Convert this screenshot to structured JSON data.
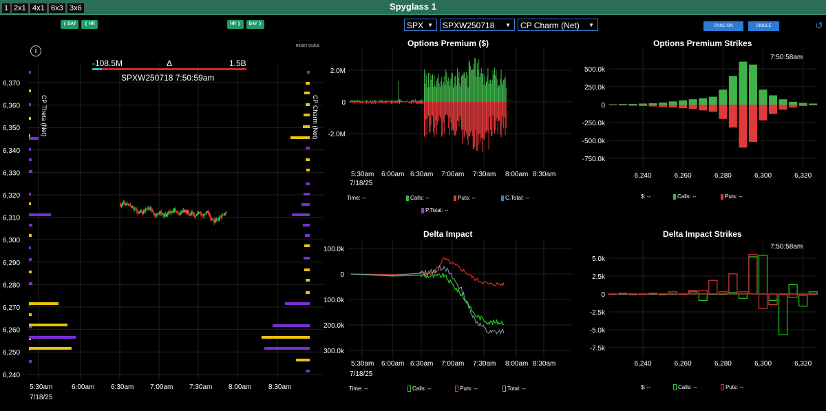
{
  "header": {
    "layouts": [
      "1",
      "2x1",
      "4x1",
      "6x3",
      "3x6"
    ],
    "title": "Spyglass 1"
  },
  "left_controls": {
    "day_left": "❬ DAY",
    "hr_left": "❬ HR",
    "hr_right": "HR ❭",
    "day_right": "DAY ❭"
  },
  "selectors": {
    "symbol": "SPX",
    "expiration": "SPXW250718",
    "metric": "CP Charm (Net)"
  },
  "buttons": {
    "sync": "SYNC ON",
    "single": "SINGLE",
    "reset_scale": "RESET SCALE"
  },
  "main_chart": {
    "info": "i",
    "delta_left": "-108.5M",
    "delta_symbol": "Δ",
    "delta_right": "1.5B",
    "subtitle": "SPXW250718 7:50:59am",
    "left_axis_label": "CP Theta (Net)",
    "right_axis_label": "CP Charm (Net)",
    "y_ticks": [
      "6,370",
      "6,360",
      "6,350",
      "6,340",
      "6,330",
      "6,320",
      "6,310",
      "6,300",
      "6,290",
      "6,280",
      "6,270",
      "6,260",
      "6,250",
      "6,240"
    ],
    "x_ticks": [
      "5:30am",
      "6:00am",
      "6:30am",
      "7:00am",
      "7:30am",
      "8:00am",
      "8:30am"
    ],
    "date": "7/18/25"
  },
  "options_premium": {
    "title": "Options Premium ($)",
    "y_ticks": [
      "2.0M",
      "0",
      "-2.0M"
    ],
    "x_ticks": [
      "5:30am",
      "6:00am",
      "6:30am",
      "7:00am",
      "7:30am",
      "8:00am",
      "8:30am"
    ],
    "date": "7/18/25",
    "legend": {
      "time": "Time:",
      "time_val": "--",
      "calls": "Calls:",
      "calls_val": "--",
      "puts": "Puts:",
      "puts_val": "--",
      "ctotal": "C.Total:",
      "ctotal_val": "--",
      "ptotal": "P.Total:",
      "ptotal_val": "--"
    }
  },
  "options_premium_strikes": {
    "title": "Options Premium Strikes",
    "time": "7:50:58am",
    "y_ticks": [
      "500.0k",
      "250.0k",
      "0",
      "-250.0k",
      "-500.0k",
      "-750.0k"
    ],
    "x_ticks": [
      "6,240",
      "6,260",
      "6,280",
      "6,300",
      "6,320"
    ],
    "legend": {
      "dollar": "$:",
      "dollar_val": "--",
      "calls": "Calls:",
      "calls_val": "--",
      "puts": "Puts:",
      "puts_val": "--"
    }
  },
  "delta_impact": {
    "title": "Delta Impact",
    "y_ticks": [
      "100.0k",
      "0",
      "-100.0k",
      "-200.0k",
      "-300.0k"
    ],
    "x_ticks": [
      "5:30am",
      "6:00am",
      "6:30am",
      "7:00am",
      "7:30am",
      "8:00am",
      "8:30am"
    ],
    "date": "7/18/25",
    "legend": {
      "time": "Time:",
      "time_val": "--",
      "calls": "Calls:",
      "calls_val": "--",
      "puts": "Puts:",
      "puts_val": "--",
      "total": "Total:",
      "total_val": "--"
    }
  },
  "delta_impact_strikes": {
    "title": "Delta Impact Strikes",
    "time": "7:50:58am",
    "y_ticks": [
      "5.0k",
      "2.5k",
      "0",
      "-2.5k",
      "-5.0k",
      "-7.5k"
    ],
    "x_ticks": [
      "6,240",
      "6,260",
      "6,280",
      "6,300",
      "6,320"
    ],
    "legend": {
      "dollar": "$:",
      "dollar_val": "--",
      "calls": "Calls:",
      "calls_val": "--",
      "puts": "Puts:",
      "puts_val": "--"
    }
  },
  "colors": {
    "header": "#2a6e56",
    "calls": "#3fb24a",
    "puts": "#e03a3a",
    "ctotal": "#3b7bd6",
    "ptotal": "#8a3ad6",
    "gold": "#e8c20c",
    "purple": "#7a2ed6",
    "accent": "#1f9a6a"
  },
  "chart_data": [
    {
      "type": "bar",
      "title": "Options Premium Strikes",
      "categories": [
        6225,
        6230,
        6235,
        6240,
        6245,
        6250,
        6255,
        6260,
        6265,
        6270,
        6275,
        6280,
        6285,
        6290,
        6295,
        6300,
        6305,
        6310,
        6315,
        6320,
        6325
      ],
      "series": [
        {
          "name": "Calls",
          "values": [
            5000,
            8000,
            10000,
            15000,
            20000,
            30000,
            45000,
            60000,
            75000,
            90000,
            110000,
            210000,
            400000,
            600000,
            560000,
            210000,
            130000,
            75000,
            40000,
            25000,
            15000
          ]
        },
        {
          "name": "Puts",
          "values": [
            -8000,
            -10000,
            -15000,
            -20000,
            -25000,
            -35000,
            -40000,
            -50000,
            -60000,
            -80000,
            -100000,
            -200000,
            -320000,
            -600000,
            -520000,
            -220000,
            -130000,
            -70000,
            -40000,
            -20000,
            -10000
          ]
        }
      ],
      "ylim": [
        -780000,
        620000
      ]
    },
    {
      "type": "bar",
      "title": "Delta Impact Strikes",
      "categories": [
        6225,
        6230,
        6235,
        6240,
        6245,
        6250,
        6255,
        6260,
        6265,
        6270,
        6275,
        6280,
        6285,
        6290,
        6295,
        6300,
        6305,
        6310,
        6315,
        6320,
        6325
      ],
      "series": [
        {
          "name": "Calls",
          "values": [
            0,
            0,
            -100,
            0,
            0,
            -100,
            0,
            0,
            300,
            -900,
            0,
            0,
            200,
            -600,
            5200,
            5400,
            -900,
            -5700,
            1300,
            -1700,
            300
          ]
        },
        {
          "name": "Puts",
          "values": [
            0,
            100,
            0,
            0,
            100,
            0,
            300,
            0,
            500,
            500,
            1900,
            300,
            2800,
            300,
            5500,
            -2000,
            -1500,
            0,
            -500,
            -200,
            0
          ]
        }
      ],
      "ylim": [
        -7800,
        6300
      ]
    },
    {
      "type": "line",
      "title": "Delta Impact",
      "x": [
        "5:30am",
        "6:00am",
        "6:30am",
        "7:00am",
        "7:30am",
        "7:50am"
      ],
      "series": [
        {
          "name": "Calls",
          "values": [
            0,
            -10000,
            5000,
            -20000,
            -150000,
            -190000
          ]
        },
        {
          "name": "Puts",
          "values": [
            0,
            -5000,
            15000,
            60000,
            -40000,
            -40000
          ]
        },
        {
          "name": "Total",
          "values": [
            0,
            -8000,
            10000,
            10000,
            -220000,
            -230000
          ]
        }
      ],
      "ylim": [
        -310000,
        110000
      ]
    },
    {
      "type": "bar",
      "title": "Options Premium ($)",
      "x": [
        "5:30am",
        "6:00am",
        "6:30am",
        "7:00am",
        "7:30am",
        "7:50am"
      ],
      "series": [
        {
          "name": "Calls",
          "values": [
            50000,
            100000,
            800000,
            1300000,
            1200000,
            600000
          ]
        },
        {
          "name": "Puts",
          "values": [
            -50000,
            -80000,
            -800000,
            -1800000,
            -2000000,
            -500000
          ]
        }
      ],
      "ylim": [
        -2800000,
        2700000
      ]
    }
  ]
}
